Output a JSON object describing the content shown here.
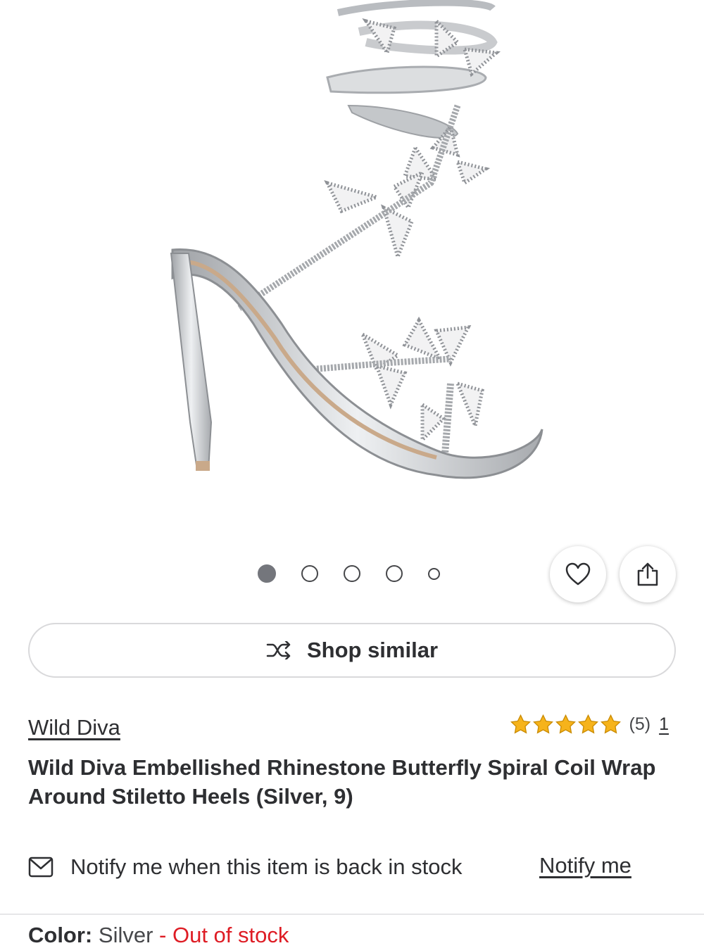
{
  "product": {
    "image_alt": "Silver rhinestone butterfly spiral coil stiletto heel",
    "gallery": {
      "total": 5,
      "active_index": 0
    },
    "brand": "Wild Diva",
    "rating": {
      "stars": 5,
      "count": "(5)",
      "qa_count": "1"
    },
    "title": "Wild Diva Embellished Rhinestone Butterfly Spiral Coil Wrap Around Stiletto Heels (Silver, 9)",
    "color_label": "Color:",
    "color_value": "Silver",
    "stock_status": "- Out of stock"
  },
  "actions": {
    "shop_similar": "Shop similar",
    "favorite_icon": "heart-icon",
    "share_icon": "share-icon"
  },
  "notify": {
    "message": "Notify me when this item is back in stock",
    "link": "Notify me"
  },
  "colors": {
    "star": "#f6b31b",
    "text": "#2e2f32",
    "out_of_stock": "#de1c24",
    "active_dot": "#74767c"
  }
}
